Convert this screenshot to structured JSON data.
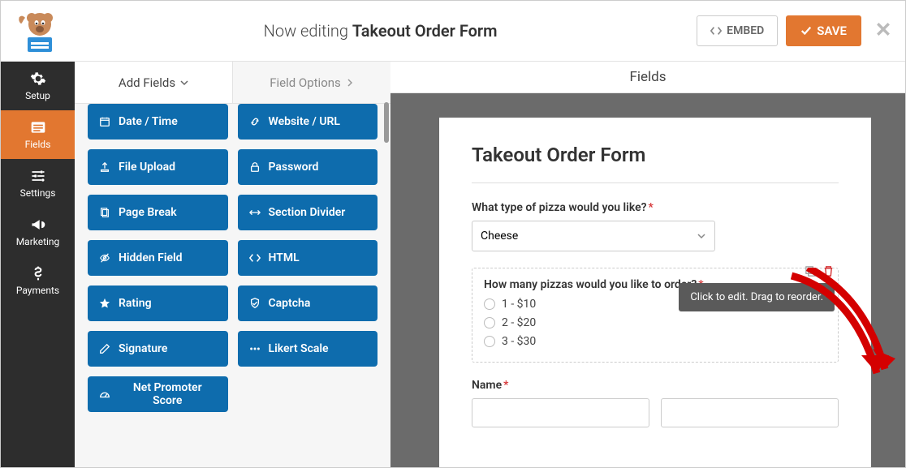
{
  "header": {
    "prefix": "Now editing",
    "form_name": "Takeout Order Form",
    "embed_label": "EMBED",
    "save_label": "SAVE"
  },
  "vnav": {
    "items": [
      {
        "id": "setup",
        "label": "Setup"
      },
      {
        "id": "fields",
        "label": "Fields"
      },
      {
        "id": "settings",
        "label": "Settings"
      },
      {
        "id": "marketing",
        "label": "Marketing"
      },
      {
        "id": "payments",
        "label": "Payments"
      }
    ],
    "active": "fields"
  },
  "panel_tabs": {
    "add_fields": "Add Fields",
    "field_options": "Field Options"
  },
  "field_buttons": [
    {
      "id": "date-time",
      "label": "Date / Time",
      "icon": "calendar"
    },
    {
      "id": "website-url",
      "label": "Website / URL",
      "icon": "link"
    },
    {
      "id": "file-upload",
      "label": "File Upload",
      "icon": "upload"
    },
    {
      "id": "password",
      "label": "Password",
      "icon": "lock"
    },
    {
      "id": "page-break",
      "label": "Page Break",
      "icon": "files"
    },
    {
      "id": "section-divider",
      "label": "Section Divider",
      "icon": "arrows-h"
    },
    {
      "id": "hidden-field",
      "label": "Hidden Field",
      "icon": "eye-slash"
    },
    {
      "id": "html",
      "label": "HTML",
      "icon": "code"
    },
    {
      "id": "rating",
      "label": "Rating",
      "icon": "star"
    },
    {
      "id": "captcha",
      "label": "Captcha",
      "icon": "shield"
    },
    {
      "id": "signature",
      "label": "Signature",
      "icon": "pencil"
    },
    {
      "id": "likert-scale",
      "label": "Likert Scale",
      "icon": "ellipsis"
    },
    {
      "id": "net-promoter",
      "label": "Net Promoter Score",
      "icon": "dashboard",
      "span2": true
    }
  ],
  "preview": {
    "section_title": "Fields",
    "form_title": "Takeout Order Form",
    "q1": {
      "label": "What type of pizza would you like?",
      "value": "Cheese"
    },
    "q2": {
      "label": "How many pizzas would you like to order?",
      "options": [
        "1 - $10",
        "2 - $20",
        "3 - $30"
      ],
      "tooltip": "Click to edit. Drag to reorder."
    },
    "q3": {
      "label": "Name"
    }
  }
}
